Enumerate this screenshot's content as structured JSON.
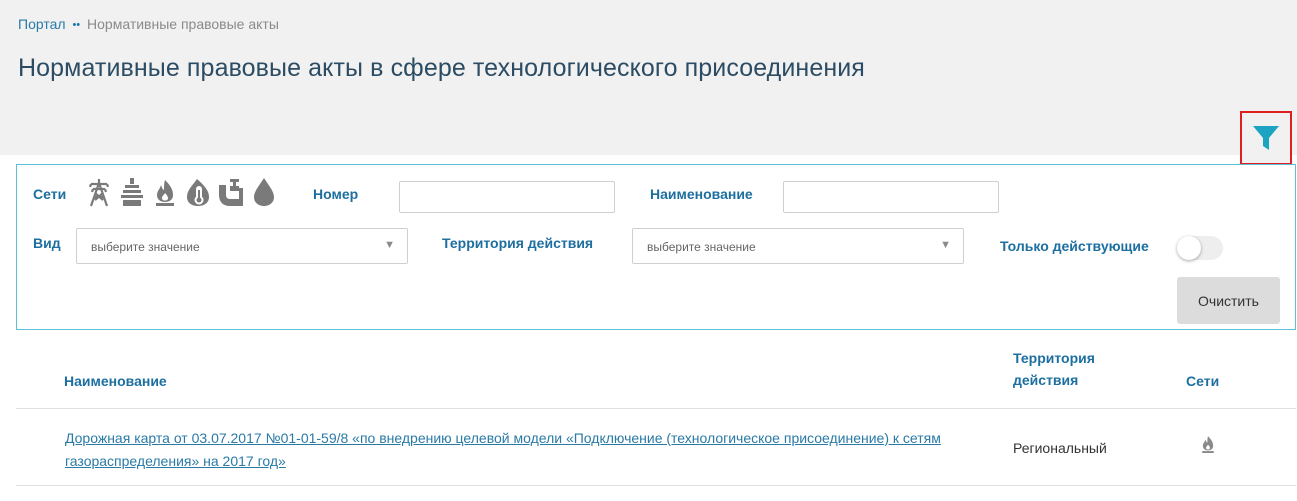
{
  "breadcrumb": {
    "home": "Портал",
    "separator": "••",
    "current": "Нормативные правовые акты"
  },
  "page_title": "Нормативные правовые акты в сфере технологического присоединения",
  "colors": {
    "accent": "#1da3c2",
    "label_blue": "#1d6fa0",
    "highlight_border": "#e02020",
    "icon_gray": "#7a7a7a"
  },
  "filter_toggle": {
    "icon": "funnel-icon"
  },
  "filters": {
    "networks_label": "Сети",
    "network_icons": [
      "power-line-icon",
      "substation-icon",
      "gas-flame-icon",
      "heat-thermometer-icon",
      "water-pipe-icon",
      "water-drop-icon"
    ],
    "number_label": "Номер",
    "number_value": "",
    "name_label": "Наименование",
    "name_value": "",
    "type_label": "Вид",
    "type_placeholder": "выберите значение",
    "territory_label": "Территория действия",
    "territory_placeholder": "выберите значение",
    "active_only_label": "Только действующие",
    "active_only_on": false,
    "clear_label": "Очистить"
  },
  "table": {
    "headers": {
      "name": "Наименование",
      "territory": "Территория действия",
      "networks": "Сети"
    },
    "rows": [
      {
        "name": "Дорожная карта от 03.07.2017 №01-01-59/8 «по внедрению целевой модели «Подключение (технологическое присоединение) к сетям газораспределения» на 2017 год»",
        "territory": "Региональный",
        "network_icon": "gas-flame-icon"
      }
    ]
  }
}
